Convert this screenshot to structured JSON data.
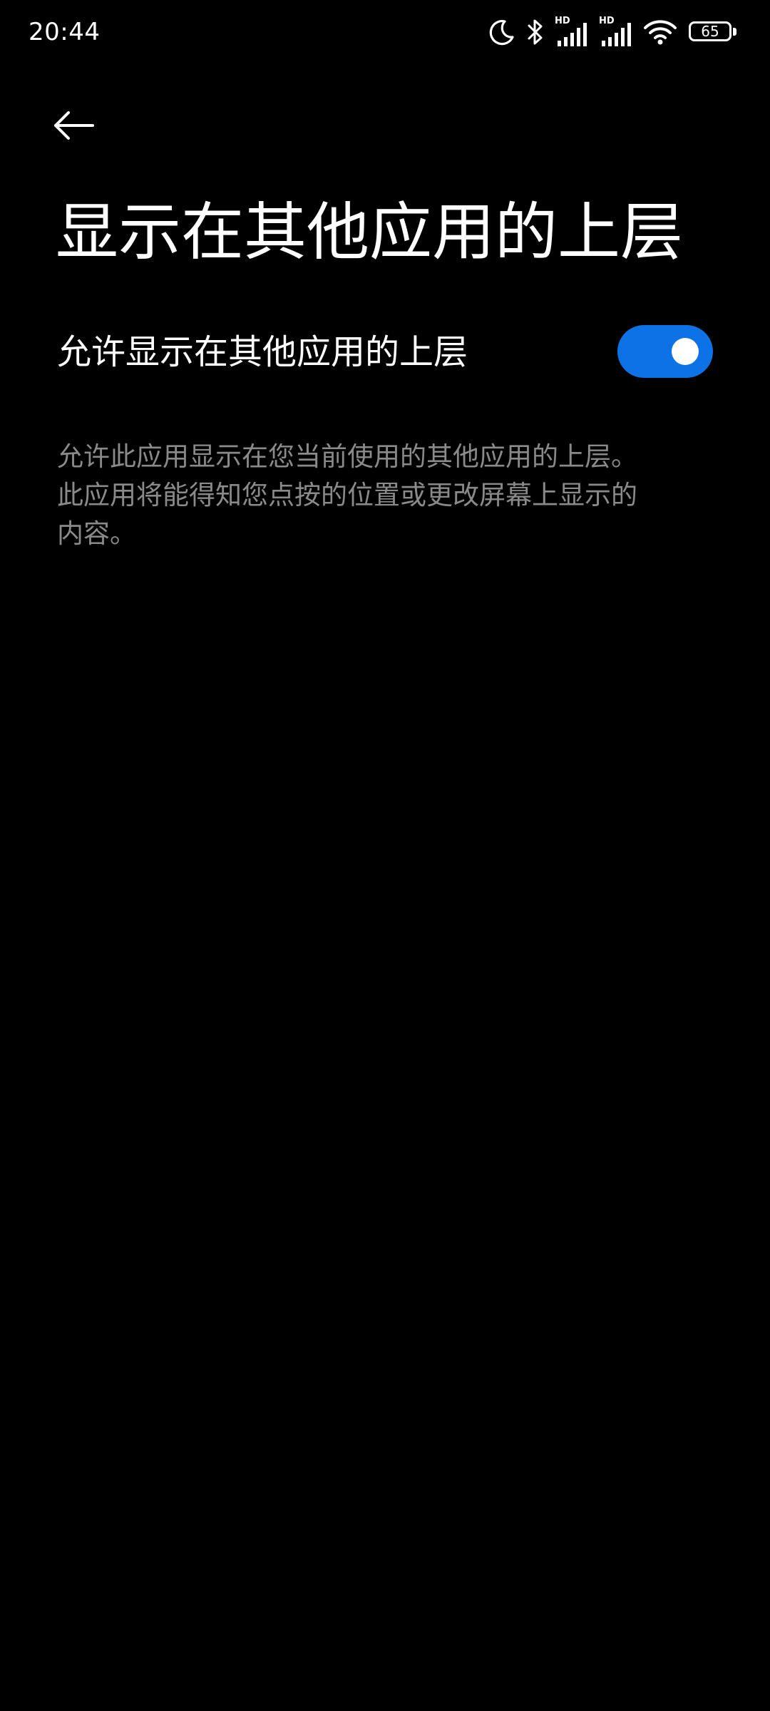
{
  "status_bar": {
    "time": "20:44",
    "icons": [
      "moon-icon",
      "bluetooth-icon",
      "hd-signal-icon",
      "hd-signal-icon",
      "wifi-icon",
      "battery-icon"
    ],
    "hd_label": "HD",
    "battery_level": "65",
    "battery_percent": 65
  },
  "header": {
    "back_icon": "arrow-left-icon",
    "title": "显示在其他应用的上层"
  },
  "setting": {
    "label": "允许显示在其他应用的上层",
    "enabled": true,
    "toggle_color": "#0d72e6"
  },
  "description": "允许此应用显示在您当前使用的其他应用的上层。此应用将能得知您点按的位置或更改屏幕上显示的内容。"
}
